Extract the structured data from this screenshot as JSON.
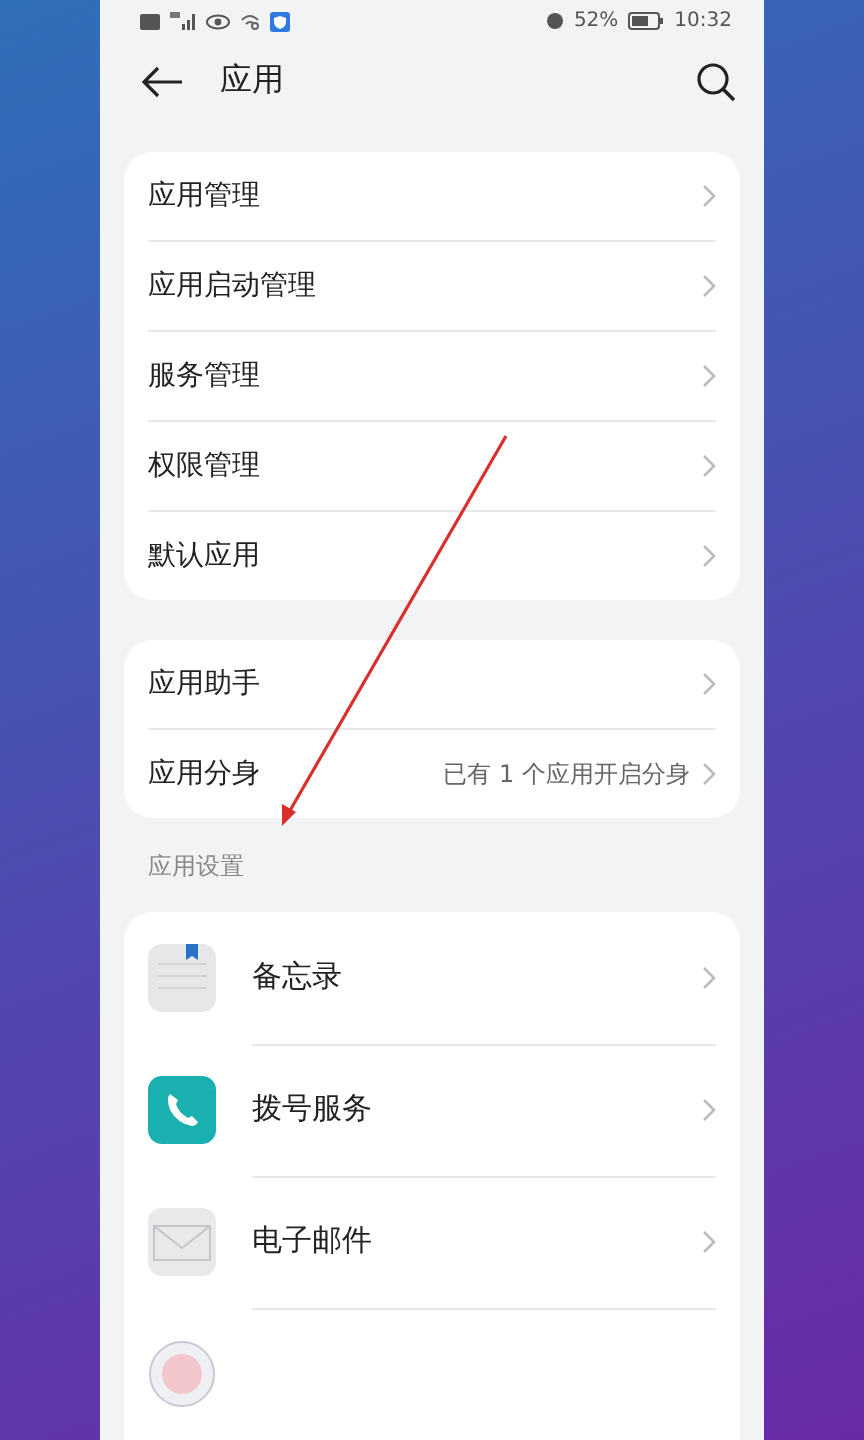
{
  "status_bar": {
    "battery_text": "52%",
    "time": "10:32"
  },
  "header": {
    "title": "应用"
  },
  "groups": [
    {
      "items": [
        {
          "label": "应用管理"
        },
        {
          "label": "应用启动管理"
        },
        {
          "label": "服务管理"
        },
        {
          "label": "权限管理"
        },
        {
          "label": "默认应用"
        }
      ]
    },
    {
      "items": [
        {
          "label": "应用助手"
        },
        {
          "label": "应用分身",
          "value": "已有 1 个应用开启分身"
        }
      ]
    }
  ],
  "section_title": "应用设置",
  "apps": [
    {
      "kind": "notes",
      "label": "备忘录"
    },
    {
      "kind": "phone",
      "label": "拨号服务"
    },
    {
      "kind": "mail",
      "label": "电子邮件"
    },
    {
      "kind": "clock"
    }
  ]
}
